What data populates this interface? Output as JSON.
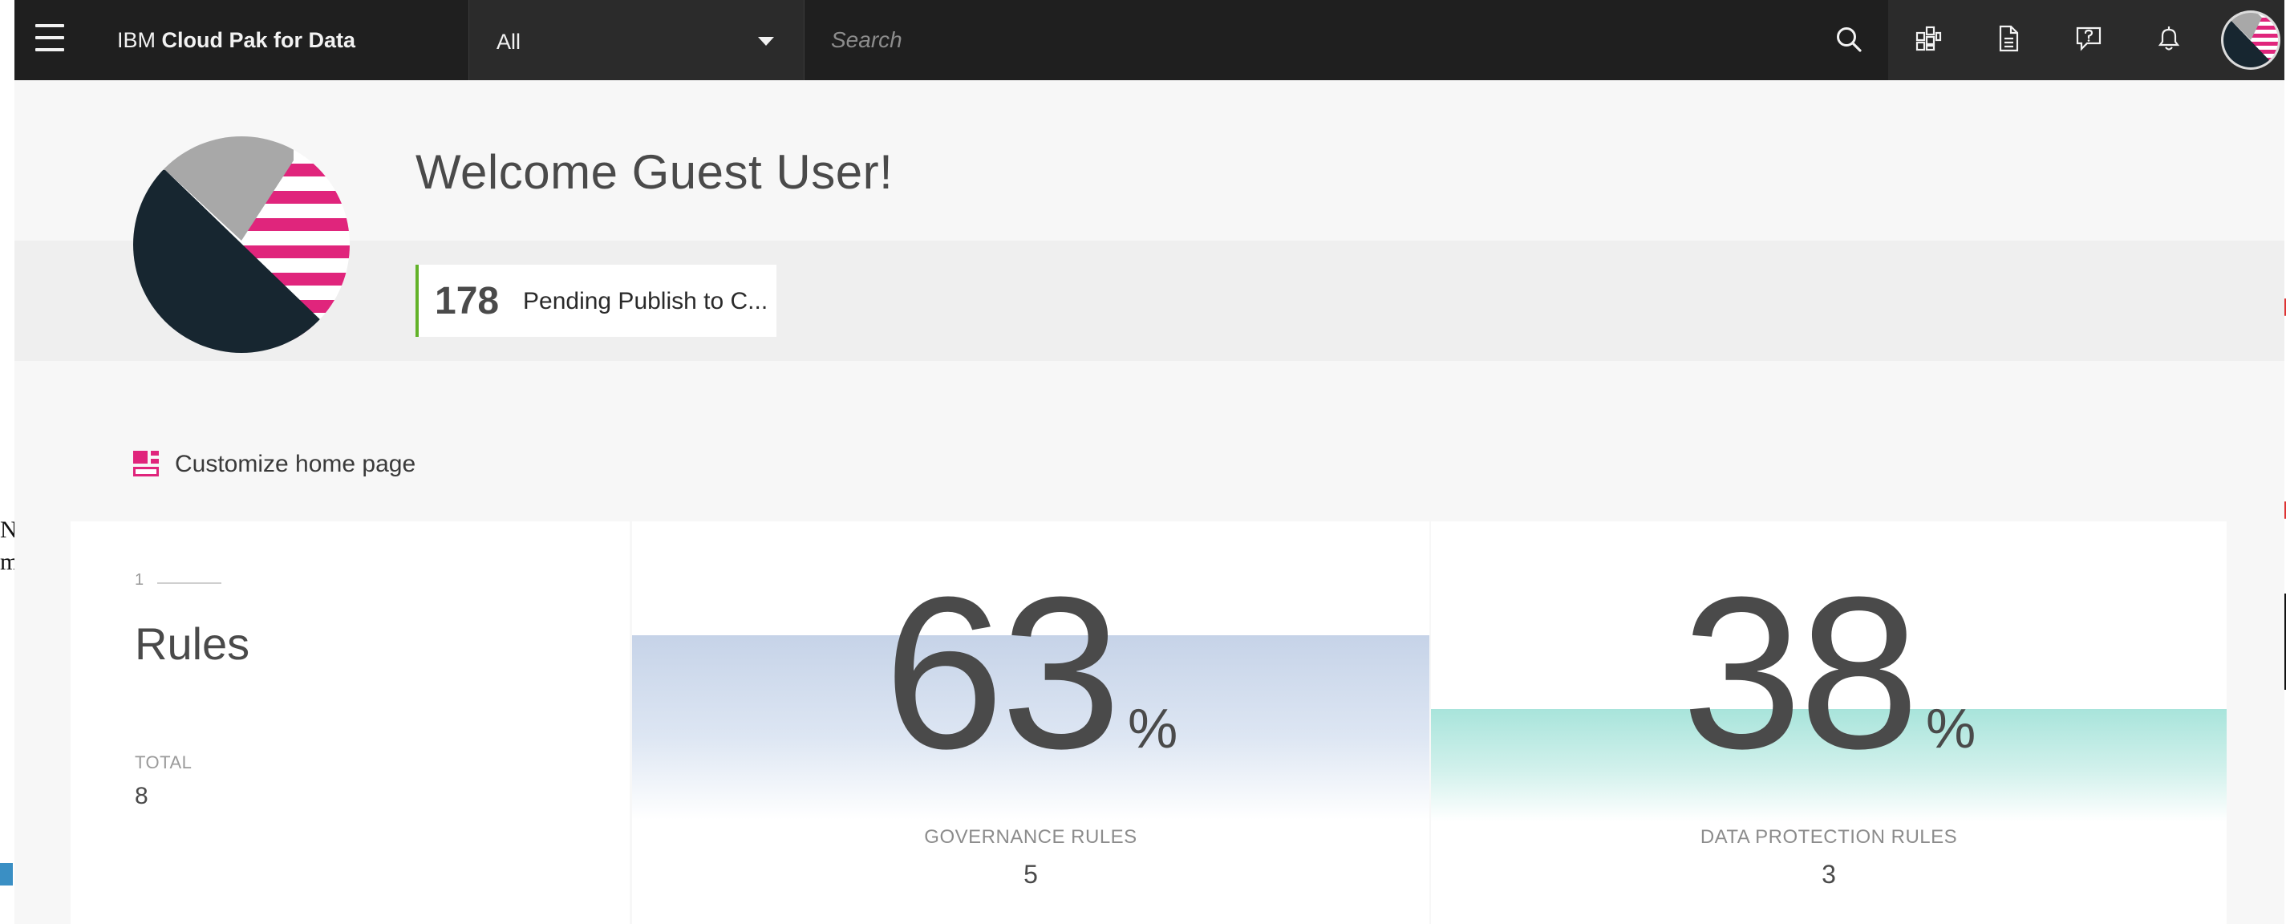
{
  "topnav": {
    "product_prefix": "IBM",
    "product_name": "Cloud Pak for Data",
    "scope_selected": "All",
    "search_placeholder": "Search",
    "icons": [
      "menu-icon",
      "search-icon",
      "catalog-icon",
      "document-icon",
      "help-icon",
      "notification-icon",
      "avatar"
    ]
  },
  "welcome": {
    "title": "Welcome Guest User!"
  },
  "pending": {
    "count": "178",
    "label": "Pending Publish to C..."
  },
  "customize": {
    "label": "Customize home page"
  },
  "cards": {
    "rules": {
      "index": "1",
      "title": "Rules",
      "total_label": "TOTAL",
      "total_value": "8"
    },
    "governance": {
      "percent": "63",
      "percent_value": 63,
      "unit": "%",
      "label": "GOVERNANCE RULES",
      "count": "5",
      "fill_color": "#c6d3e8"
    },
    "data_protection": {
      "percent": "38",
      "percent_value": 38,
      "unit": "%",
      "label": "DATA PROTECTION RULES",
      "count": "3",
      "fill_color": "#a8e4db"
    }
  },
  "colors": {
    "nav_bg": "#1f1f1f",
    "accent_magenta": "#e0257c",
    "accent_green": "#62b229",
    "avatar_dark": "#172630",
    "avatar_gray": "#a8a8a8"
  },
  "background_window": {
    "left_edge_text": [
      "N",
      "m"
    ]
  }
}
